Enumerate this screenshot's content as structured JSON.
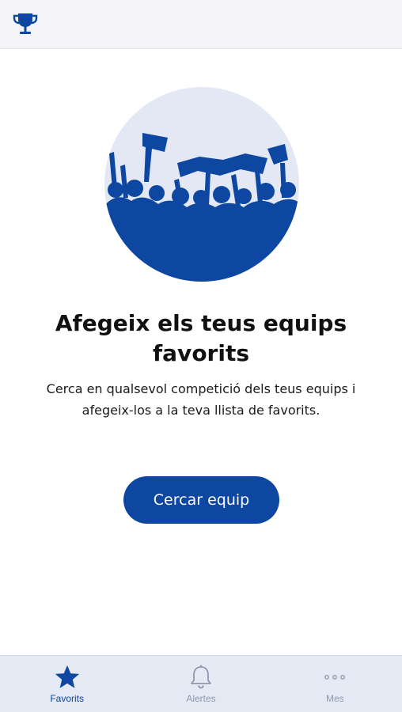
{
  "header": {
    "logo_icon": "trophy-icon"
  },
  "hero": {
    "illustration": "crowd-fans-illustration"
  },
  "empty_state": {
    "title": "Afegeix els teus equips favorits",
    "description": "Cerca en qualsevol competició dels teus equips i afegeix-los a la teva llista de favorits."
  },
  "cta": {
    "label": "Cercar equip"
  },
  "tabs": [
    {
      "label": "Favorits",
      "icon": "star-icon",
      "active": true
    },
    {
      "label": "Alertes",
      "icon": "bell-icon",
      "active": false
    },
    {
      "label": "Mes",
      "icon": "more-dots-icon",
      "active": false
    }
  ],
  "colors": {
    "primary": "#0d47a1",
    "hero_bg": "#e3e8f4",
    "tab_bar_bg": "#e4e9f3",
    "inactive": "#8d99b2"
  }
}
